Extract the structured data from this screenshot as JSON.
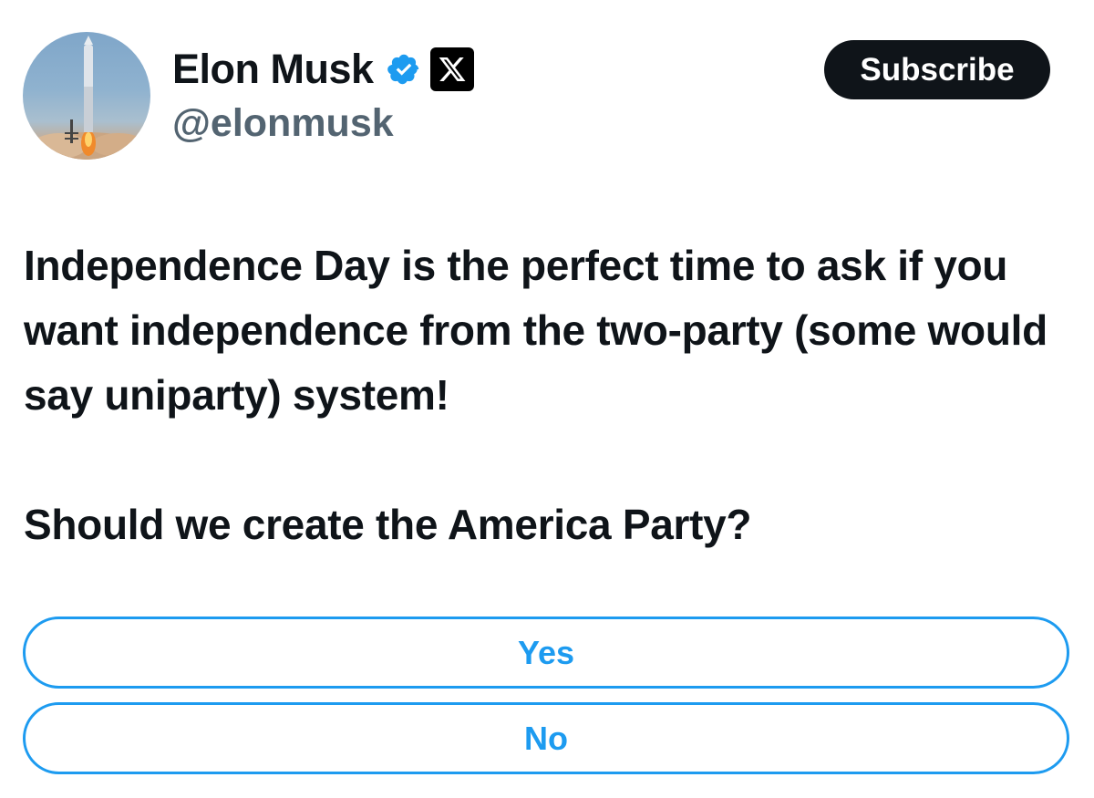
{
  "author": {
    "display_name": "Elon Musk",
    "handle": "@elonmusk",
    "avatar_icon": "rocket-launch-avatar",
    "verified_icon": "verified-badge-icon",
    "affiliation_icon": "x-logo-icon"
  },
  "actions": {
    "subscribe_label": "Subscribe"
  },
  "tweet": {
    "body": "Independence Day is the perfect time to ask if you want independence from the two-party (some would say uniparty) system!",
    "question": "Should we create the America Party?"
  },
  "poll": {
    "options": [
      {
        "label": "Yes"
      },
      {
        "label": "No"
      }
    ]
  },
  "colors": {
    "accent": "#1d9bf0",
    "text": "#0f1419",
    "secondary_text": "#536471",
    "button_bg": "#0f1419"
  }
}
